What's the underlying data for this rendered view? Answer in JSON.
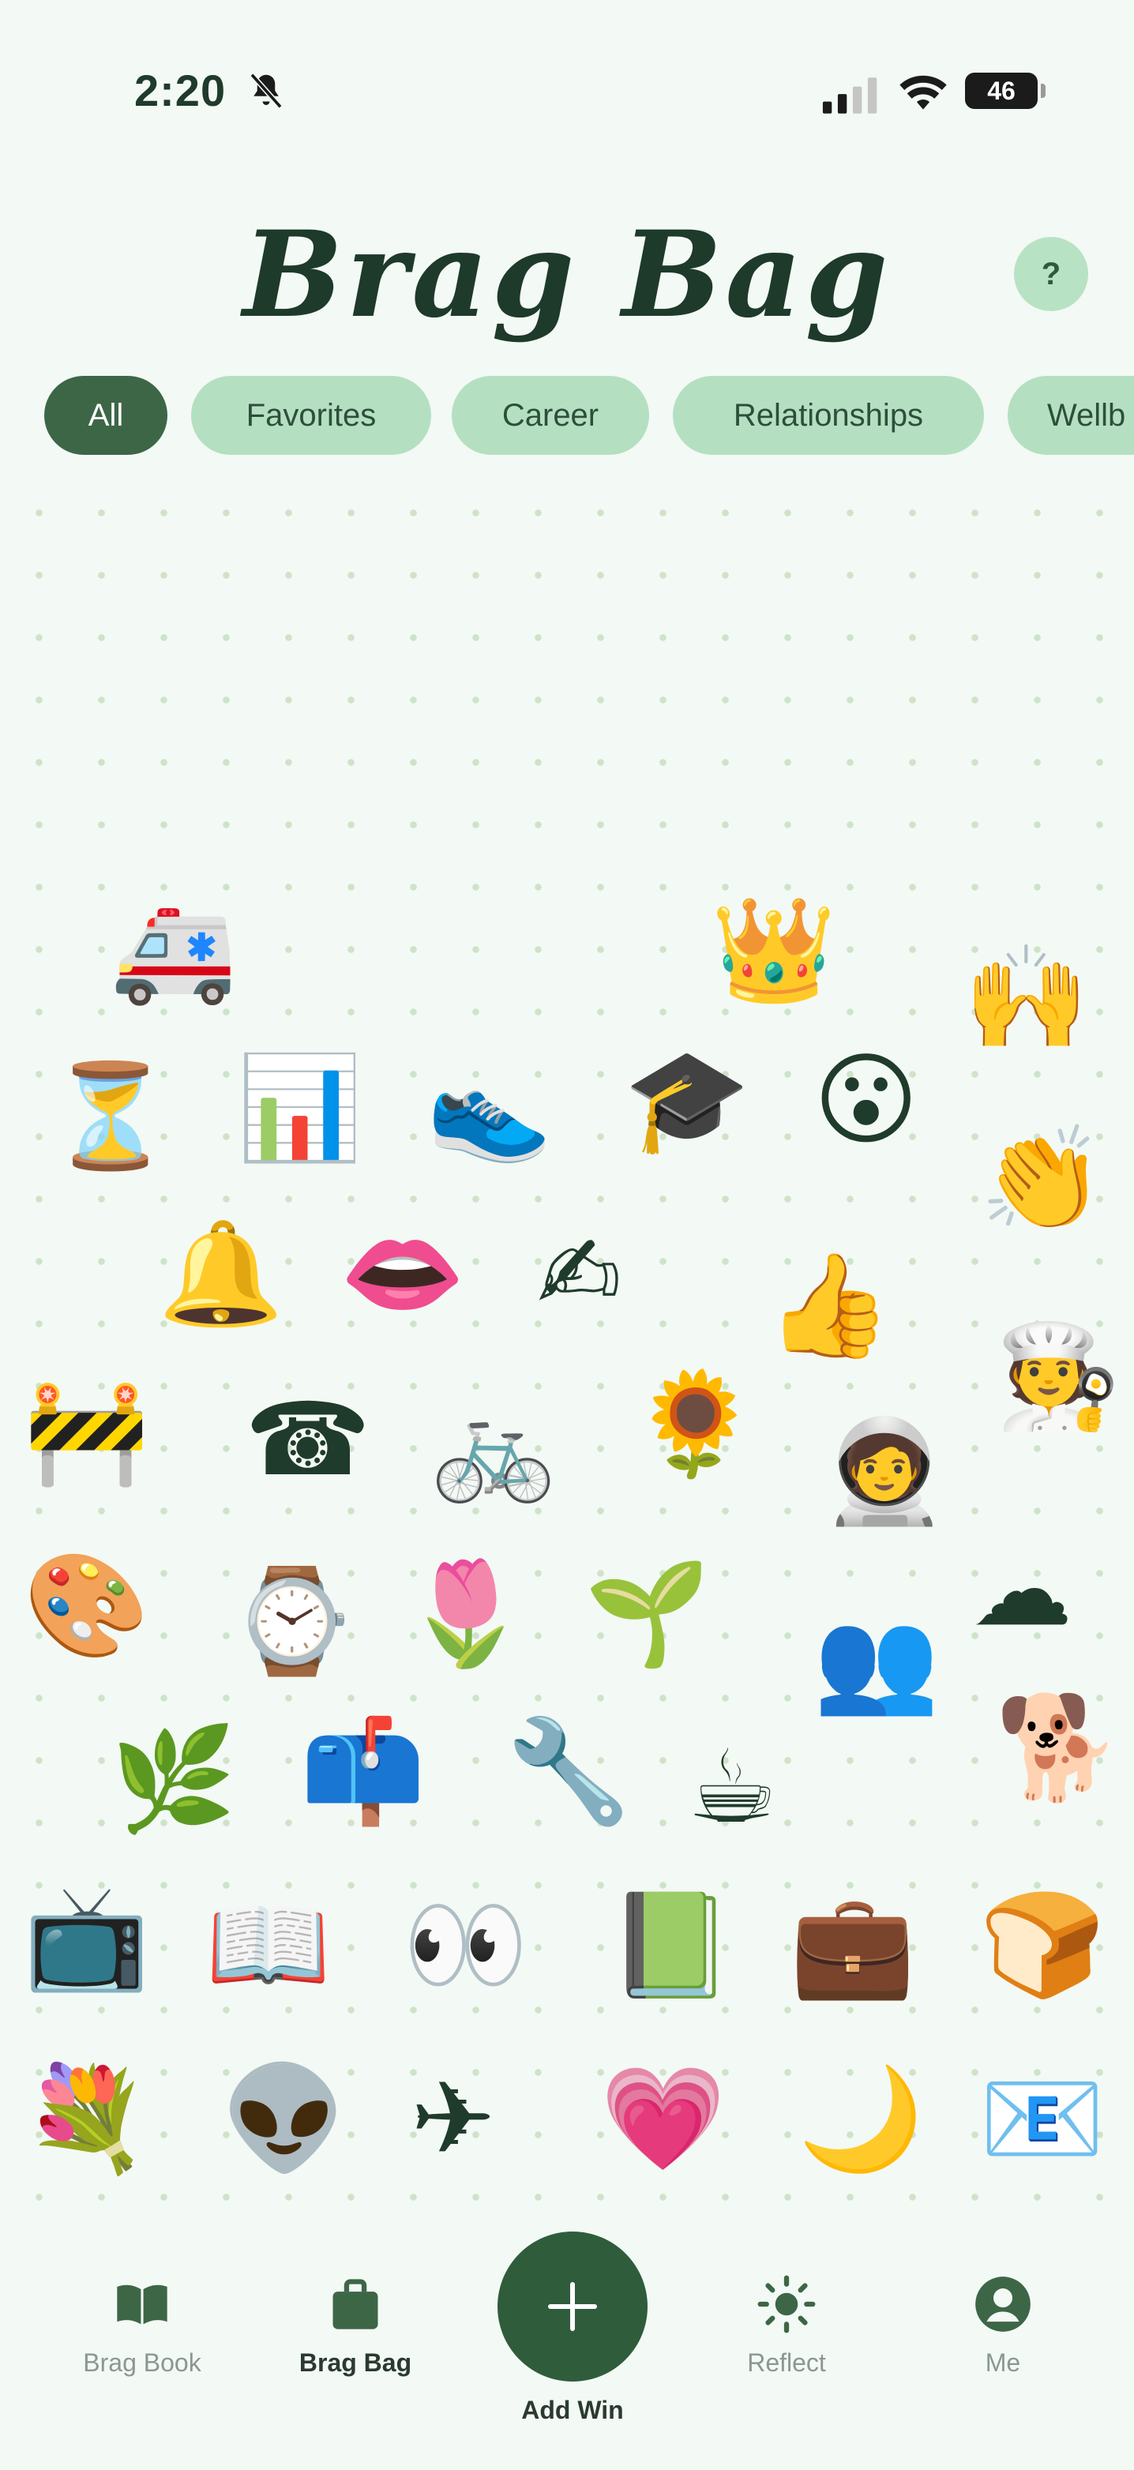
{
  "status_bar": {
    "time": "2:20",
    "battery": "46"
  },
  "header": {
    "title": "Brag Bag",
    "help_label": "?"
  },
  "categories": [
    "All",
    "Favorites",
    "Career",
    "Relationships",
    "Wellb"
  ],
  "stickers": [
    {
      "name": "ambulance-sticker",
      "glyph": "🚑"
    },
    {
      "name": "crown-sticker",
      "glyph": "👑"
    },
    {
      "name": "raised-hands-sticker",
      "glyph": "🙌"
    },
    {
      "name": "hourglass-sticker",
      "glyph": "⏳"
    },
    {
      "name": "bar-chart-sticker",
      "glyph": "📊"
    },
    {
      "name": "sneaker-sticker",
      "glyph": "👟"
    },
    {
      "name": "graduation-cap-sticker",
      "glyph": "🎓"
    },
    {
      "name": "surprised-face-sticker",
      "glyph": "😮"
    },
    {
      "name": "clapping-hands-sticker",
      "glyph": "👏"
    },
    {
      "name": "bell-sticker",
      "glyph": "🔔"
    },
    {
      "name": "lips-sticker",
      "glyph": "👄"
    },
    {
      "name": "writing-hand-sticker",
      "glyph": "✍"
    },
    {
      "name": "thumbs-up-sticker",
      "glyph": "👍"
    },
    {
      "name": "chef-sticker",
      "glyph": "🧑‍🍳"
    },
    {
      "name": "construction-barrier-sticker",
      "glyph": "🚧"
    },
    {
      "name": "telephone-sticker",
      "glyph": "☎"
    },
    {
      "name": "bicycle-sticker",
      "glyph": "🚲"
    },
    {
      "name": "sunflower-sticker",
      "glyph": "🌻"
    },
    {
      "name": "astronaut-sticker",
      "glyph": "🧑‍🚀"
    },
    {
      "name": "cloud-sticker",
      "glyph": "☁"
    },
    {
      "name": "palette-sticker",
      "glyph": "🎨"
    },
    {
      "name": "watch-sticker",
      "glyph": "⌚"
    },
    {
      "name": "tulip-sticker",
      "glyph": "🌷"
    },
    {
      "name": "seedling-sticker",
      "glyph": "🌱"
    },
    {
      "name": "people-silhouette-sticker",
      "glyph": "👥"
    },
    {
      "name": "dog-sticker",
      "glyph": "🐕"
    },
    {
      "name": "herb-sticker",
      "glyph": "🌿"
    },
    {
      "name": "mailbox-sticker",
      "glyph": "📫"
    },
    {
      "name": "wrench-sticker",
      "glyph": "🔧"
    },
    {
      "name": "hot-beverage-sticker",
      "glyph": "☕"
    },
    {
      "name": "television-sticker",
      "glyph": "📺"
    },
    {
      "name": "open-book-sticker",
      "glyph": "📖"
    },
    {
      "name": "eyes-sticker",
      "glyph": "👀"
    },
    {
      "name": "green-book-sticker",
      "glyph": "📗"
    },
    {
      "name": "briefcase-sticker",
      "glyph": "💼"
    },
    {
      "name": "bread-sticker",
      "glyph": "🍞"
    },
    {
      "name": "bouquet-sticker",
      "glyph": "💐"
    },
    {
      "name": "alien-sticker",
      "glyph": "👽"
    },
    {
      "name": "airplane-sticker",
      "glyph": "✈"
    },
    {
      "name": "heart-sticker",
      "glyph": "💗"
    },
    {
      "name": "crescent-moon-sticker",
      "glyph": "🌙"
    },
    {
      "name": "email-sticker",
      "glyph": "📧"
    }
  ],
  "nav": {
    "brag_book": "Brag Book",
    "brag_bag": "Brag Bag",
    "add_win": "Add Win",
    "reflect": "Reflect",
    "me": "Me"
  },
  "colors": {
    "background": "#f3f9f4",
    "chip": "#b4e0c1",
    "chip_active": "#3d6647",
    "fab": "#2f5c3b",
    "title": "#1e3a2a"
  }
}
